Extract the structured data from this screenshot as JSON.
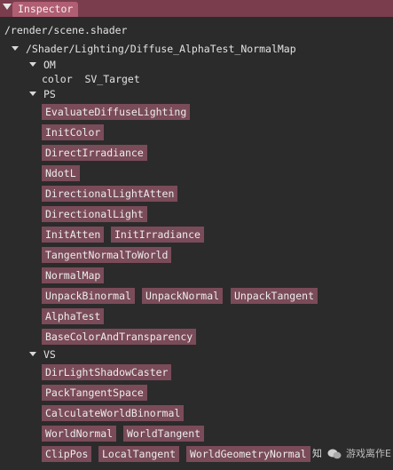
{
  "window": {
    "tab_label": "Inspector"
  },
  "file_path": "/render/scene.shader",
  "tree": {
    "root_label": "/Shader/Lighting/Diffuse_AlphaTest_NormalMap",
    "om": {
      "label": "OM",
      "outputs": [
        {
          "text": "color  SV_Target"
        }
      ]
    },
    "ps": {
      "label": "PS",
      "nodes": [
        "EvaluateDiffuseLighting",
        "InitColor",
        "DirectIrradiance",
        "NdotL",
        "DirectionalLightAtten",
        "DirectionalLight",
        "InitAtten",
        "InitIrradiance",
        "TangentNormalToWorld",
        "NormalMap",
        "UnpackBinormal",
        "UnpackNormal",
        "UnpackTangent",
        "AlphaTest",
        "BaseColorAndTransparency"
      ]
    },
    "vs": {
      "label": "VS",
      "nodes": [
        "DirLightShadowCaster",
        "PackTangentSpace",
        "CalculateWorldBinormal",
        "WorldNormal",
        "WorldTangent",
        "ClipPos",
        "LocalTangent",
        "WorldGeometryNormal"
      ]
    }
  },
  "watermark": {
    "prefix": "知",
    "text": "游戏离作E"
  }
}
